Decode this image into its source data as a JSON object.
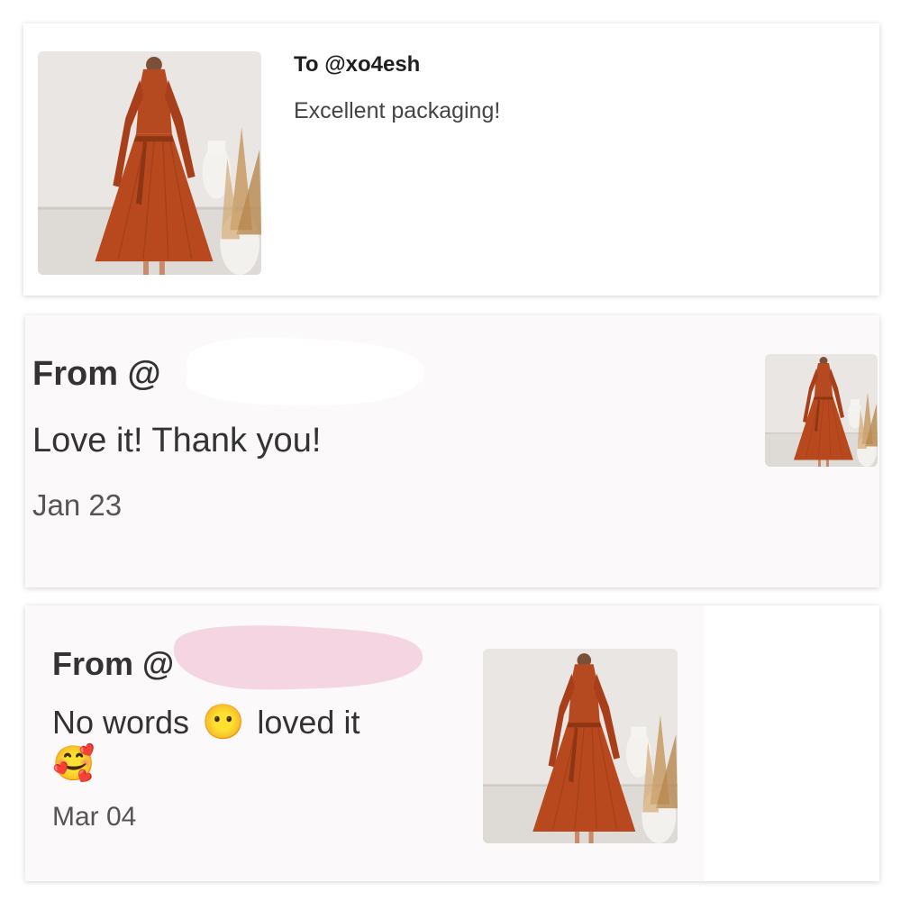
{
  "cards": [
    {
      "heading": "To @xo4esh",
      "message": "Excellent packaging!"
    },
    {
      "heading": "From @",
      "message": "Love it! Thank you!",
      "date": "Jan 23"
    },
    {
      "heading": "From @",
      "message_part1": "No words",
      "message_part2": "loved it",
      "emoji_inline": "😶",
      "emoji_trailing": "🥰",
      "date": "Mar 04"
    }
  ],
  "colors": {
    "dress": "#b5491f",
    "redaction_white": "#ffffff",
    "redaction_pink": "#f6d5e2"
  },
  "icons": [
    "product-photo",
    "no-mouth-face-emoji",
    "smiling-face-with-hearts-emoji"
  ]
}
